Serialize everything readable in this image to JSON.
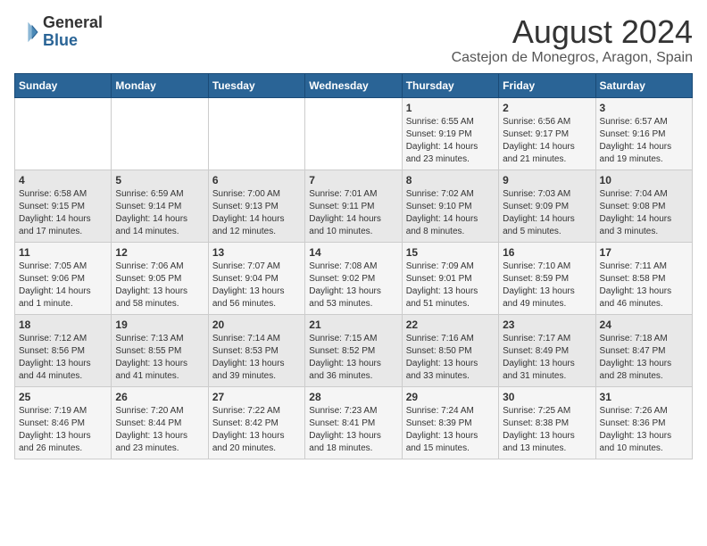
{
  "logo": {
    "general": "General",
    "blue": "Blue"
  },
  "title": "August 2024",
  "subtitle": "Castejon de Monegros, Aragon, Spain",
  "headers": [
    "Sunday",
    "Monday",
    "Tuesday",
    "Wednesday",
    "Thursday",
    "Friday",
    "Saturday"
  ],
  "weeks": [
    [
      {
        "day": "",
        "info": ""
      },
      {
        "day": "",
        "info": ""
      },
      {
        "day": "",
        "info": ""
      },
      {
        "day": "",
        "info": ""
      },
      {
        "day": "1",
        "info": "Sunrise: 6:55 AM\nSunset: 9:19 PM\nDaylight: 14 hours\nand 23 minutes."
      },
      {
        "day": "2",
        "info": "Sunrise: 6:56 AM\nSunset: 9:17 PM\nDaylight: 14 hours\nand 21 minutes."
      },
      {
        "day": "3",
        "info": "Sunrise: 6:57 AM\nSunset: 9:16 PM\nDaylight: 14 hours\nand 19 minutes."
      }
    ],
    [
      {
        "day": "4",
        "info": "Sunrise: 6:58 AM\nSunset: 9:15 PM\nDaylight: 14 hours\nand 17 minutes."
      },
      {
        "day": "5",
        "info": "Sunrise: 6:59 AM\nSunset: 9:14 PM\nDaylight: 14 hours\nand 14 minutes."
      },
      {
        "day": "6",
        "info": "Sunrise: 7:00 AM\nSunset: 9:13 PM\nDaylight: 14 hours\nand 12 minutes."
      },
      {
        "day": "7",
        "info": "Sunrise: 7:01 AM\nSunset: 9:11 PM\nDaylight: 14 hours\nand 10 minutes."
      },
      {
        "day": "8",
        "info": "Sunrise: 7:02 AM\nSunset: 9:10 PM\nDaylight: 14 hours\nand 8 minutes."
      },
      {
        "day": "9",
        "info": "Sunrise: 7:03 AM\nSunset: 9:09 PM\nDaylight: 14 hours\nand 5 minutes."
      },
      {
        "day": "10",
        "info": "Sunrise: 7:04 AM\nSunset: 9:08 PM\nDaylight: 14 hours\nand 3 minutes."
      }
    ],
    [
      {
        "day": "11",
        "info": "Sunrise: 7:05 AM\nSunset: 9:06 PM\nDaylight: 14 hours\nand 1 minute."
      },
      {
        "day": "12",
        "info": "Sunrise: 7:06 AM\nSunset: 9:05 PM\nDaylight: 13 hours\nand 58 minutes."
      },
      {
        "day": "13",
        "info": "Sunrise: 7:07 AM\nSunset: 9:04 PM\nDaylight: 13 hours\nand 56 minutes."
      },
      {
        "day": "14",
        "info": "Sunrise: 7:08 AM\nSunset: 9:02 PM\nDaylight: 13 hours\nand 53 minutes."
      },
      {
        "day": "15",
        "info": "Sunrise: 7:09 AM\nSunset: 9:01 PM\nDaylight: 13 hours\nand 51 minutes."
      },
      {
        "day": "16",
        "info": "Sunrise: 7:10 AM\nSunset: 8:59 PM\nDaylight: 13 hours\nand 49 minutes."
      },
      {
        "day": "17",
        "info": "Sunrise: 7:11 AM\nSunset: 8:58 PM\nDaylight: 13 hours\nand 46 minutes."
      }
    ],
    [
      {
        "day": "18",
        "info": "Sunrise: 7:12 AM\nSunset: 8:56 PM\nDaylight: 13 hours\nand 44 minutes."
      },
      {
        "day": "19",
        "info": "Sunrise: 7:13 AM\nSunset: 8:55 PM\nDaylight: 13 hours\nand 41 minutes."
      },
      {
        "day": "20",
        "info": "Sunrise: 7:14 AM\nSunset: 8:53 PM\nDaylight: 13 hours\nand 39 minutes."
      },
      {
        "day": "21",
        "info": "Sunrise: 7:15 AM\nSunset: 8:52 PM\nDaylight: 13 hours\nand 36 minutes."
      },
      {
        "day": "22",
        "info": "Sunrise: 7:16 AM\nSunset: 8:50 PM\nDaylight: 13 hours\nand 33 minutes."
      },
      {
        "day": "23",
        "info": "Sunrise: 7:17 AM\nSunset: 8:49 PM\nDaylight: 13 hours\nand 31 minutes."
      },
      {
        "day": "24",
        "info": "Sunrise: 7:18 AM\nSunset: 8:47 PM\nDaylight: 13 hours\nand 28 minutes."
      }
    ],
    [
      {
        "day": "25",
        "info": "Sunrise: 7:19 AM\nSunset: 8:46 PM\nDaylight: 13 hours\nand 26 minutes."
      },
      {
        "day": "26",
        "info": "Sunrise: 7:20 AM\nSunset: 8:44 PM\nDaylight: 13 hours\nand 23 minutes."
      },
      {
        "day": "27",
        "info": "Sunrise: 7:22 AM\nSunset: 8:42 PM\nDaylight: 13 hours\nand 20 minutes."
      },
      {
        "day": "28",
        "info": "Sunrise: 7:23 AM\nSunset: 8:41 PM\nDaylight: 13 hours\nand 18 minutes."
      },
      {
        "day": "29",
        "info": "Sunrise: 7:24 AM\nSunset: 8:39 PM\nDaylight: 13 hours\nand 15 minutes."
      },
      {
        "day": "30",
        "info": "Sunrise: 7:25 AM\nSunset: 8:38 PM\nDaylight: 13 hours\nand 13 minutes."
      },
      {
        "day": "31",
        "info": "Sunrise: 7:26 AM\nSunset: 8:36 PM\nDaylight: 13 hours\nand 10 minutes."
      }
    ]
  ]
}
